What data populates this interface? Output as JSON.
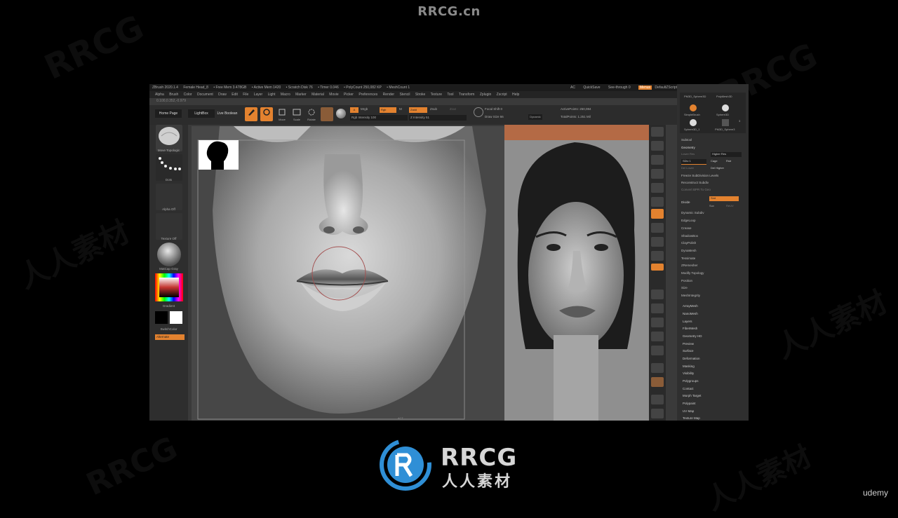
{
  "watermark": {
    "top": "RRCG.cn",
    "logo_text": "RRCG",
    "logo_sub": "人人素材",
    "faint1": "RRCG",
    "faint2": "人人素材"
  },
  "udemy": "udemy",
  "app": {
    "title_items": [
      "ZBrush 2020.1.4",
      "Female Head_8",
      "• Free Mem 3.478GB",
      "• Active Mem 1420",
      "• Scratch Disk 76",
      "• Timer 0.046",
      "• PolyCount 250,082 KP",
      "• MeshCount 1"
    ],
    "title_right": [
      "AC",
      "QuickSave",
      "See-through 0",
      "Menus",
      "DefaultZScript"
    ],
    "menus": [
      "Alpha",
      "Brush",
      "Color",
      "Document",
      "Draw",
      "Edit",
      "File",
      "Layer",
      "Light",
      "Macro",
      "Marker",
      "Material",
      "Movie",
      "Picker",
      "Preferences",
      "Render",
      "Stencil",
      "Stroke",
      "Texture",
      "Tool",
      "Transform",
      "Zplugin",
      "Zscript",
      "Help"
    ],
    "coords": "0.100,0.352,-0.979",
    "toolbar": {
      "home": "Home Page",
      "lightbox": "LightBox",
      "boolean": "Live Boolean",
      "edit": "Edit",
      "draw": "Draw",
      "move": "Move",
      "scale": "Scale",
      "rotate": "Rotate",
      "a": "A",
      "mrgb": "Mrgb",
      "rgb": "Rgb",
      "m": "M",
      "zadd": "Zadd",
      "zsub": "Zsub",
      "zcut": "Zcut",
      "rgb_intensity": "Rgb Intensity 100",
      "z_intensity": "Z Intensity 51",
      "focal_shift": "Focal Shift 0",
      "draw_size": "Draw Size 66",
      "dynamic": "Dynamic",
      "active_points": "ActivePoints: 250,084",
      "total_points": "TotalPoints: 1.251 Mil"
    },
    "left": {
      "brush": "Move Topologic",
      "stroke": "Dots",
      "alpha": "Alpha Off",
      "texture": "Texture Off",
      "material": "MatCap Gray",
      "gradient": "Gradient",
      "switch": "SwitchColor",
      "alternate": "Alternate"
    },
    "shelf": [
      "BPR",
      "SPix 3",
      "Scroll",
      "Zoom",
      "Actual",
      "AAHalf",
      "Persp",
      "Floor",
      "Local",
      "LSym",
      "Qxyz",
      "Frame",
      "Move",
      "Scale",
      "Rotate",
      "Line Fill",
      "PolyF",
      "Transp",
      "Solo",
      "Xpose"
    ],
    "right": {
      "tools": [
        "PM3D_Sphere3D",
        "PolyMesh3D",
        "SimpleBrush",
        "Sphere3D",
        "Sphere3D_1",
        "PM3D_Sphere3"
      ],
      "tool_count": "3",
      "subtool": "Subtool",
      "geometry": "Geometry",
      "lower_res": "Lower Res",
      "higher_res": "Higher Res",
      "sdiv": "SDiv 1",
      "cage": "Cage",
      "rstr": "Rstr",
      "del_lower": "Del Lower",
      "del_higher": "Del Higher",
      "freeze": "Freeze SubDivision Levels",
      "reconstruct": "Reconstruct Subdiv",
      "convert": "Convert BPR To Geo",
      "divide": "Divide",
      "smt": "Smt",
      "suv": "Suv",
      "reuv": "ReUV",
      "geo_items": [
        "Dynamic Subdiv",
        "EdgeLoop",
        "Crease",
        "ShadowBox",
        "ClayPolish",
        "DynaMesh",
        "Tessimate",
        "ZRemesher",
        "Modify Topology",
        "Position",
        "Size",
        "MeshIntegrity"
      ],
      "tool_items": [
        "ArrayMesh",
        "NanoMesh",
        "Layers",
        "FiberMesh",
        "Geometry HD",
        "Preview",
        "Surface",
        "Deformation",
        "Masking",
        "Visibility",
        "Polygroups",
        "Contact",
        "Morph Target",
        "Polypaint",
        "UV Map",
        "Texture Map"
      ]
    },
    "bottom_label": "ACT"
  }
}
